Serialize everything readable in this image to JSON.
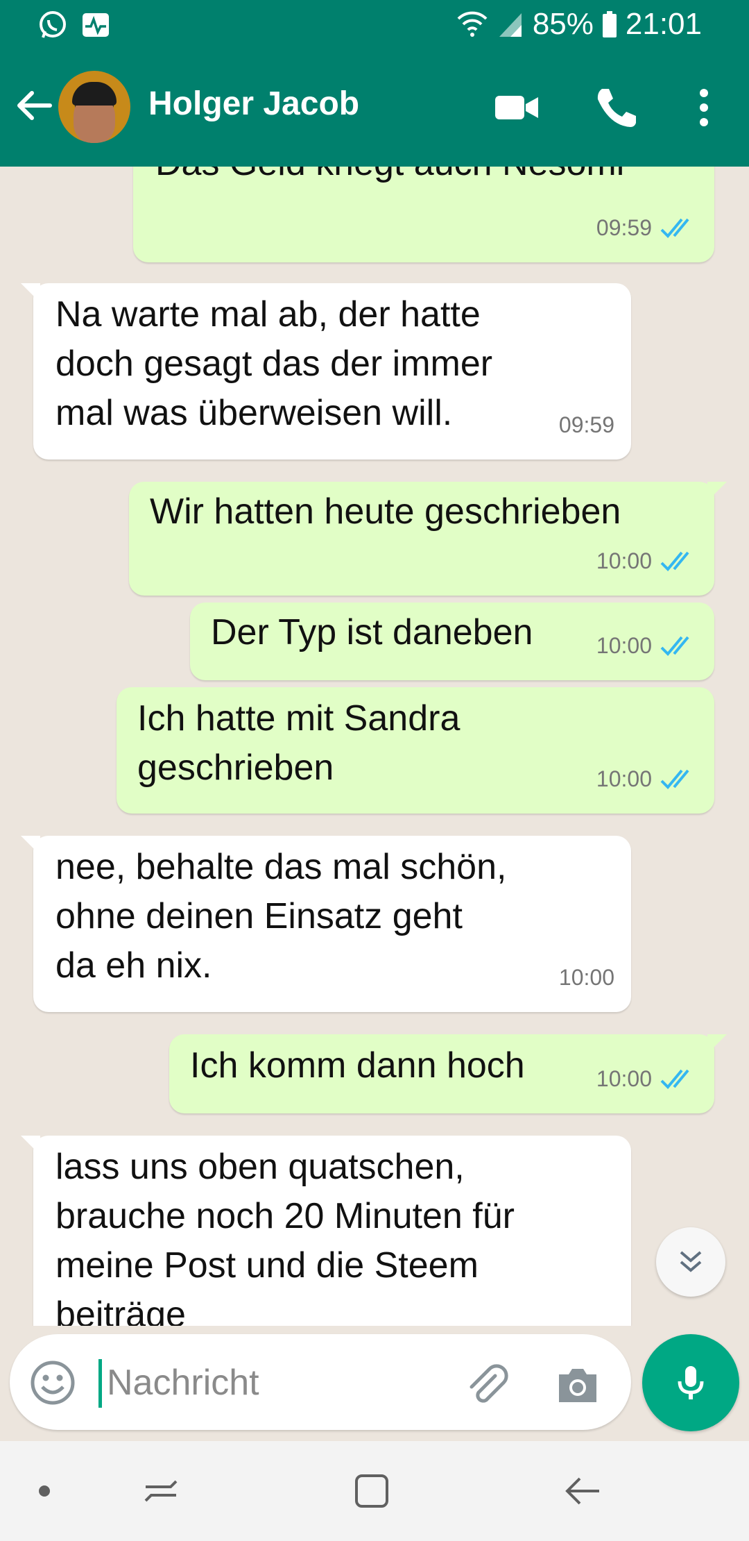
{
  "status_bar": {
    "battery": "85%",
    "time": "21:01"
  },
  "header": {
    "contact_name": "Holger Jacob"
  },
  "messages": [
    {
      "dir": "out",
      "lines": [
        "Das Geld kriegt auch Nesomi"
      ],
      "time": "09:59",
      "read": true
    },
    {
      "dir": "in",
      "lines": [
        "Na warte mal ab, der hatte",
        "doch gesagt das der immer",
        "mal was überweisen will."
      ],
      "time": "09:59"
    },
    {
      "dir": "out",
      "lines": [
        "Wir hatten heute geschrieben"
      ],
      "time": "10:00",
      "read": true
    },
    {
      "dir": "out",
      "lines": [
        "Der Typ ist daneben"
      ],
      "time": "10:00",
      "read": true
    },
    {
      "dir": "out",
      "lines": [
        "Ich hatte mit Sandra",
        "geschrieben"
      ],
      "time": "10:00",
      "read": true
    },
    {
      "dir": "in",
      "lines": [
        "nee, behalte das mal schön,",
        "ohne deinen Einsatz geht",
        "da eh nix."
      ],
      "time": "10:00"
    },
    {
      "dir": "out",
      "lines": [
        "Ich komm dann hoch"
      ],
      "time": "10:00",
      "read": true
    },
    {
      "dir": "in",
      "lines": [
        "lass uns oben quatschen,",
        "brauche noch 20 Minuten für",
        "meine Post und die Steem",
        "beiträge"
      ]
    }
  ],
  "composer": {
    "placeholder": "Nachricht"
  },
  "colors": {
    "header": "#00806d",
    "outgoing_bubble": "#e1fec6",
    "incoming_bubble": "#ffffff",
    "accent": "#00a884",
    "read_tick": "#34b7f1"
  },
  "icons": [
    "whatsapp-icon",
    "pulse-icon",
    "wifi-icon",
    "signal-icon",
    "battery-icon",
    "back-arrow-icon",
    "video-call-icon",
    "phone-icon",
    "more-vert-icon",
    "double-check-icon",
    "chevron-double-down-icon",
    "emoji-icon",
    "paperclip-icon",
    "camera-icon",
    "mic-icon",
    "recent-apps-icon",
    "home-icon",
    "nav-back-icon"
  ]
}
